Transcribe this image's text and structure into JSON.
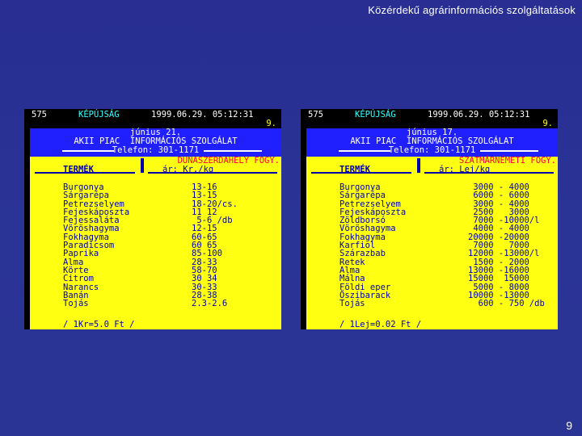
{
  "slide": {
    "title": "Közérdekű agrárinformációs szolgáltatások",
    "page_number": "9"
  },
  "panels": [
    {
      "page": "575",
      "service": "KÉPÚJSÁG",
      "datetime": "1999.06.29. 05:12:31",
      "subpage": "9.",
      "date": "június 21.",
      "heading": "AKII PIAC  INFORMÁCIÓS SZOLGÁLAT",
      "phone": "Telefon: 301-1171",
      "location": "DUNASZERDAHELY FOGY.",
      "col_product": "TERMÉK",
      "col_price": "ár: Kr./kg",
      "rows": [
        {
          "name": "Burgonya",
          "price": "13-16"
        },
        {
          "name": "Sárgarépa",
          "price": "13-15"
        },
        {
          "name": "Petrezselyem",
          "price": "18-20/cs."
        },
        {
          "name": "Fejeskáposzta",
          "price": "11 12"
        },
        {
          "name": "Fejessaláta",
          "price": " 5-6 /db"
        },
        {
          "name": "Vöröshagyma",
          "price": "12-15"
        },
        {
          "name": "Fokhagyma",
          "price": "60-65"
        },
        {
          "name": "Paradicsom",
          "price": "60 65"
        },
        {
          "name": "Paprika",
          "price": "85-100"
        },
        {
          "name": "Alma",
          "price": "28-33"
        },
        {
          "name": "Körte",
          "price": "58-70"
        },
        {
          "name": "Citrom",
          "price": "30 34"
        },
        {
          "name": "Narancs",
          "price": "30-33"
        },
        {
          "name": "Banán",
          "price": "28-38"
        },
        {
          "name": "Tojás",
          "price": "2.3-2.6"
        }
      ],
      "footer": "/ 1Kr=5.0 Ft /"
    },
    {
      "page": "575",
      "service": "KÉPÚJSÁG",
      "datetime": "1999.06.29. 05:12:31",
      "subpage": "9.",
      "date": "június 17.",
      "heading": "AKII PIAC  INFORMÁCIÓS SZOLGÁLAT",
      "phone": "Telefon: 301-1171",
      "location": "SZATMÁRNÉMETI FOGY.",
      "col_product": "TERMÉK",
      "col_price": "ár: Lej/kg",
      "rows": [
        {
          "name": "Burgonya",
          "price": " 3000 - 4000"
        },
        {
          "name": "Sárgarépa",
          "price": " 6000 - 6000"
        },
        {
          "name": "Petrezselyem",
          "price": " 3000 - 4000"
        },
        {
          "name": "Fejeskáposzta",
          "price": " 2500   3000"
        },
        {
          "name": "Zöldborsó",
          "price": " 7000 -10000/l"
        },
        {
          "name": "Vöröshagyma",
          "price": " 4000 - 4000"
        },
        {
          "name": "Fokhagyma",
          "price": "20000 -20000"
        },
        {
          "name": "Karfiol",
          "price": " 7000   7000"
        },
        {
          "name": "Szárazbab",
          "price": "12000 -13000/l"
        },
        {
          "name": "Retek",
          "price": " 1500 - 2000"
        },
        {
          "name": "Alma",
          "price": "13000 -16000"
        },
        {
          "name": "Málna",
          "price": "15000  15000"
        },
        {
          "name": "Földi eper",
          "price": " 5000 - 8000"
        },
        {
          "name": "Őszibarack",
          "price": "10000 -13000"
        },
        {
          "name": "Tojás",
          "price": "  600 - 750 /db"
        }
      ],
      "footer": "/ 1Lej=0.02 Ft /"
    }
  ]
}
